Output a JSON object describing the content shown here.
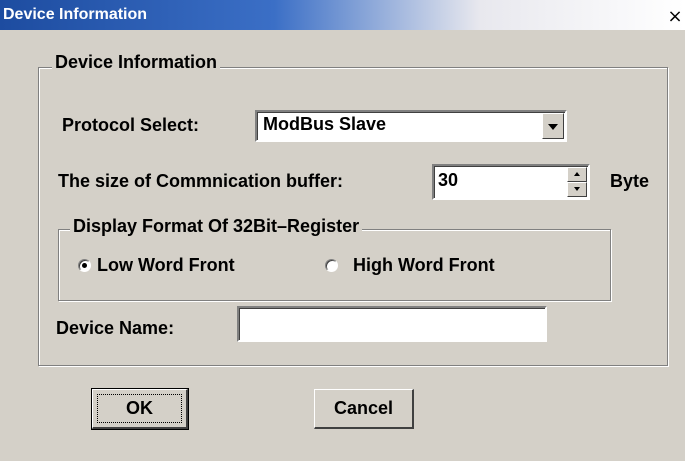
{
  "window": {
    "title": "Device Information",
    "close_glyph": "×"
  },
  "group_main": {
    "legend": "Device Information"
  },
  "protocol": {
    "label": "Protocol Select:",
    "selected": "ModBus Slave"
  },
  "buffer": {
    "label": "The size of Commnication buffer:",
    "value": "30",
    "unit": "Byte"
  },
  "register_format": {
    "legend": "Display Format Of 32Bit–Register",
    "options": [
      {
        "label": "Low Word Front",
        "selected": true
      },
      {
        "label": "High Word Front",
        "selected": false
      }
    ]
  },
  "device_name": {
    "label": "Device Name:",
    "value": ""
  },
  "buttons": {
    "ok": "OK",
    "cancel": "Cancel"
  },
  "icons": {
    "close": "close-icon",
    "dropdown": "chevron-down-icon",
    "spin_up": "spin-up-icon",
    "spin_down": "spin-down-icon"
  }
}
